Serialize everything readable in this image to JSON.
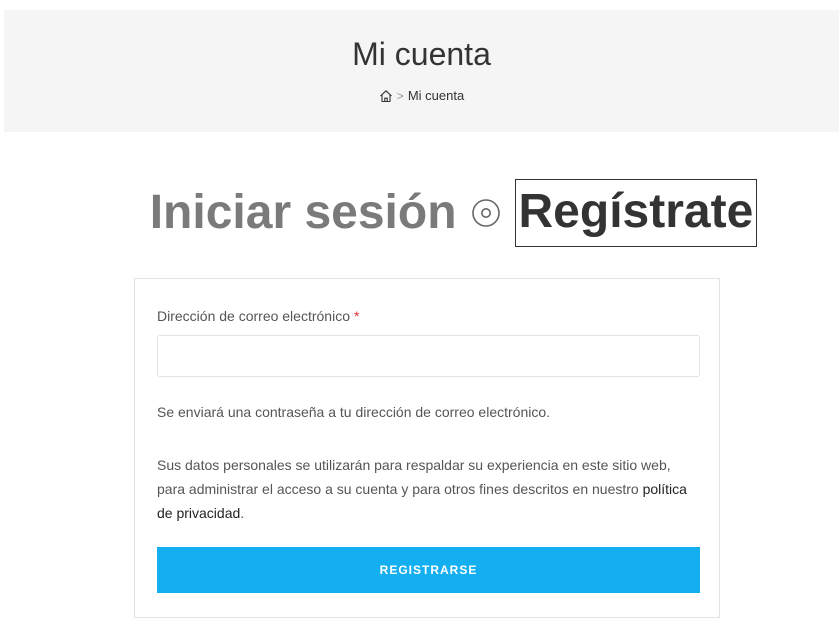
{
  "header": {
    "title": "Mi cuenta",
    "breadcrumb": {
      "home_icon": "home-icon",
      "separator": ">",
      "current": "Mi cuenta"
    }
  },
  "tabs": {
    "login": "Iniciar sesión",
    "toggle_icon": "radio-toggle-icon",
    "register": "Regístrate"
  },
  "form": {
    "email_label": "Dirección de correo electrónico",
    "required_mark": "*",
    "email_value": "",
    "password_note": "Se enviará una contraseña a tu dirección de correo electrónico.",
    "privacy_text": "Sus datos personales se utilizarán para respaldar su experiencia en este sitio web, para administrar el acceso a su cuenta y para otros fines descritos en nuestro ",
    "privacy_link": "política de privacidad",
    "privacy_end": ".",
    "submit_label": "REGISTRARSE"
  },
  "colors": {
    "accent": "#13aff0",
    "required": "#dd3333",
    "header_bg": "#f5f5f5"
  }
}
